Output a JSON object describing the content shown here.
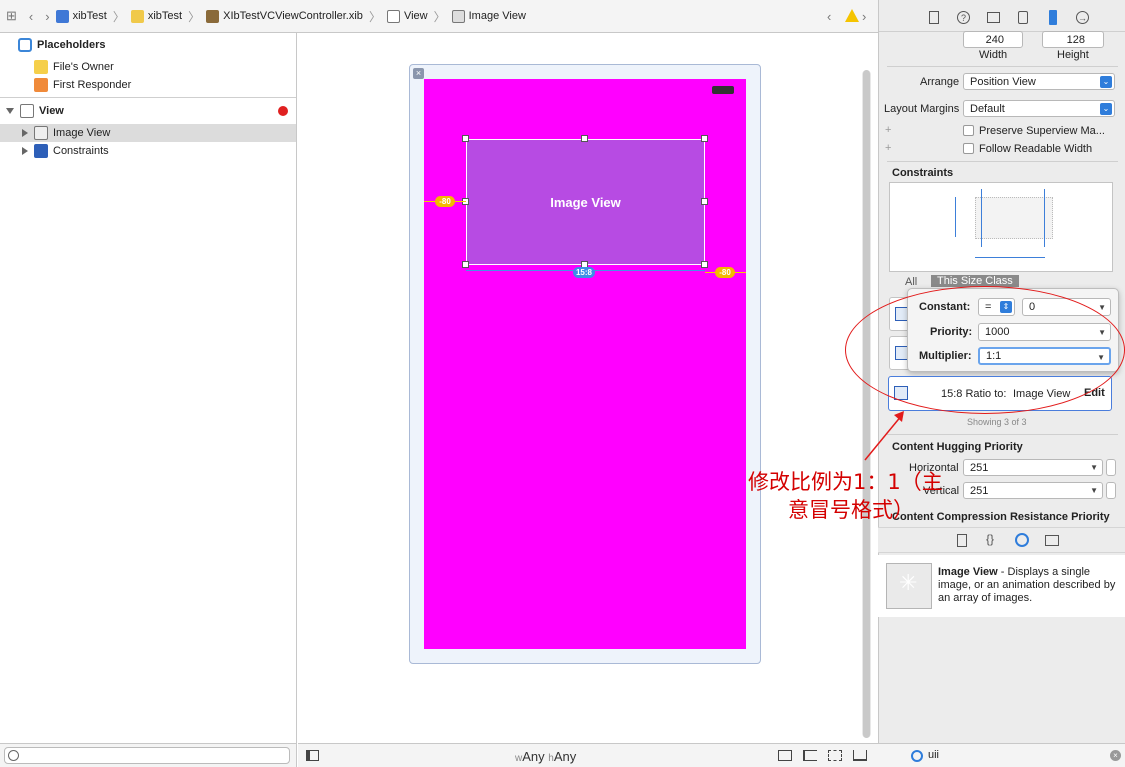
{
  "breadcrumb": [
    "xibTest",
    "xibTest",
    "XIbTestVCViewController.xib",
    "View",
    "Image View"
  ],
  "outline": {
    "placeholders_label": "Placeholders",
    "files_owner": "File's Owner",
    "first_responder": "First Responder",
    "view": "View",
    "image_view": "Image View",
    "constraints": "Constraints"
  },
  "canvas": {
    "image_view_label": "Image View",
    "leading_constant": "-80",
    "trailing_constant": "-80",
    "ratio_badge": "15:8",
    "size_class_w_prefix": "w",
    "size_class_w": "Any",
    "size_class_h_prefix": "h",
    "size_class_h": "Any"
  },
  "inspector": {
    "width_value": "240",
    "height_value": "128",
    "width_label": "Width",
    "height_label": "Height",
    "arrange_label": "Arrange",
    "arrange_value": "Position View",
    "layout_margins_label": "Layout Margins",
    "layout_margins_value": "Default",
    "preserve_label": "Preserve Superview Ma...",
    "follow_label": "Follow Readable Width",
    "constraints_header": "Constraints",
    "tab_all": "All",
    "tab_size_class": "This Size Class",
    "ratio_row_text": "15:8 Ratio to:",
    "ratio_row_target": "Image View",
    "edit_label": "Edit",
    "showing": "Showing 3 of 3",
    "hugging_header": "Content Hugging Priority",
    "horizontal_label": "Horizontal",
    "horizontal_value": "251",
    "vertical_label": "Vertical",
    "vertical_value": "251",
    "compression_header": "Content Compression Resistance Priority"
  },
  "popover": {
    "constant_label": "Constant:",
    "relation": "=",
    "constant_value": "0",
    "priority_label": "Priority:",
    "priority_value": "1000",
    "multiplier_label": "Multiplier:",
    "multiplier_value": "1:1"
  },
  "annotation": {
    "line1": "修改比例为1：1（主",
    "line2": "意冒号格式）"
  },
  "library": {
    "title": "Image View",
    "description": " - Displays a single image, or an animation described by an array of images.",
    "filter_value": "uii"
  },
  "colors": {
    "magenta": "#ff00ff",
    "image_view": "#b74be3",
    "accent": "#2f7ddb",
    "annotation_red": "#e21b1b"
  }
}
